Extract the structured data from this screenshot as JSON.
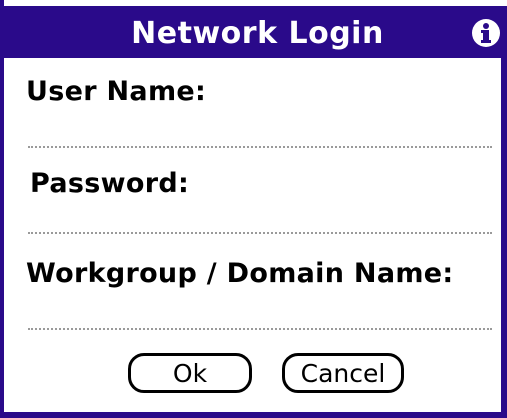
{
  "dialog": {
    "title": "Network Login",
    "info_icon": "info-circle-icon"
  },
  "fields": {
    "user_name": {
      "label": "User Name:",
      "value": ""
    },
    "password": {
      "label": "Password:",
      "value": ""
    },
    "workgroup": {
      "label": "Workgroup / Domain Name:",
      "value": ""
    }
  },
  "buttons": {
    "ok_label": "Ok",
    "cancel_label": "Cancel"
  },
  "colors": {
    "title_bar": "#2a0a8a",
    "title_text": "#ffffff"
  }
}
